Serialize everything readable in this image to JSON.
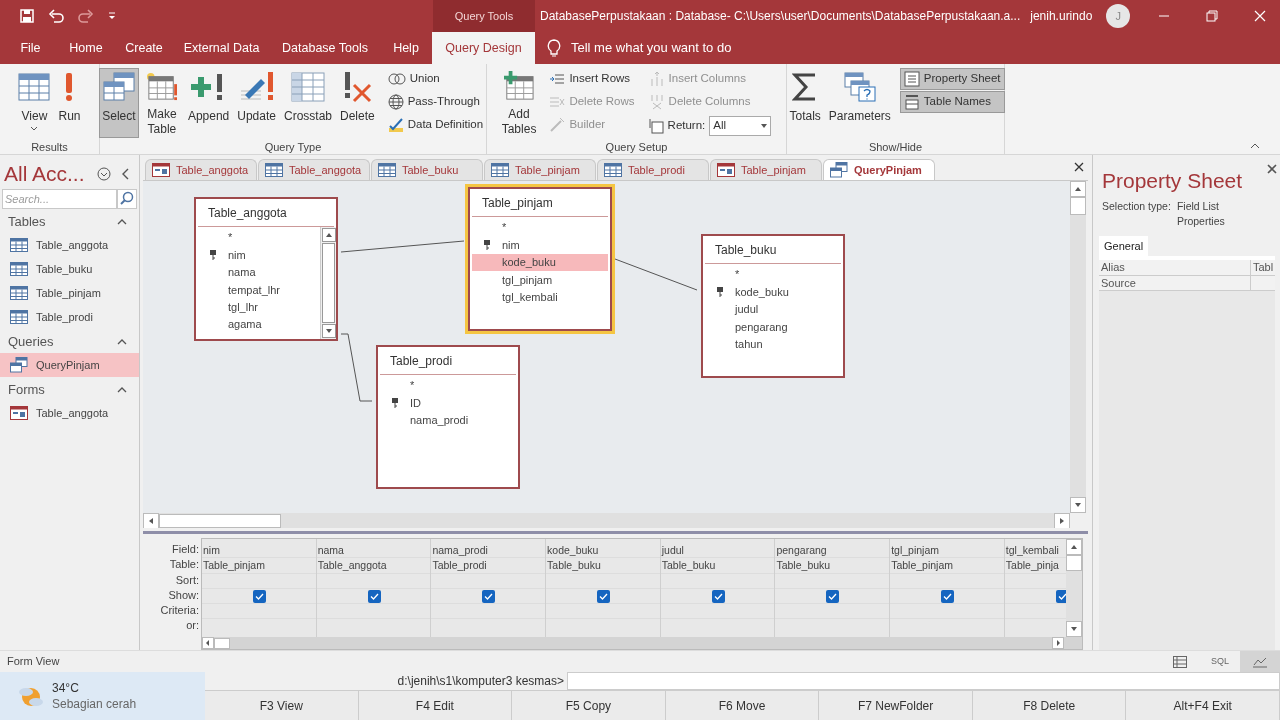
{
  "title_bar": {
    "context_tab": "Query Tools",
    "title": "DatabasePerpustakaan : Database- C:\\Users\\user\\Documents\\DatabasePerpustakaan.a...",
    "user": "jenih.urindo",
    "avatar_initial": "J"
  },
  "ribbon_tabs": [
    {
      "label": "File",
      "selected": false
    },
    {
      "label": "Home",
      "selected": false
    },
    {
      "label": "Create",
      "selected": false
    },
    {
      "label": "External Data",
      "selected": false
    },
    {
      "label": "Database Tools",
      "selected": false
    },
    {
      "label": "Help",
      "selected": false
    },
    {
      "label": "Query Design",
      "selected": true
    }
  ],
  "tell_me": "Tell me what you want to do",
  "ribbon_groups": [
    {
      "label": "Results",
      "commands": [
        {
          "kind": "large",
          "label": "View",
          "selected": false,
          "disabled": false
        },
        {
          "kind": "large",
          "label": "Run",
          "selected": false,
          "disabled": false
        }
      ]
    },
    {
      "label": "Query Type",
      "commands": [
        {
          "kind": "large",
          "label": "Select",
          "selected": true,
          "disabled": false
        },
        {
          "kind": "large",
          "label": "Make Table",
          "selected": false,
          "disabled": false
        },
        {
          "kind": "large",
          "label": "Append",
          "selected": false,
          "disabled": false
        },
        {
          "kind": "large",
          "label": "Update",
          "selected": false,
          "disabled": false
        },
        {
          "kind": "large",
          "label": "Crosstab",
          "selected": false,
          "disabled": false
        },
        {
          "kind": "large",
          "label": "Delete",
          "selected": false,
          "disabled": false
        },
        {
          "kind": "small",
          "label": "Union",
          "selected": false,
          "disabled": false
        },
        {
          "kind": "small",
          "label": "Pass-Through",
          "selected": false,
          "disabled": false
        },
        {
          "kind": "small",
          "label": "Data Definition",
          "selected": false,
          "disabled": false
        }
      ]
    },
    {
      "label": "Query Setup",
      "commands": [
        {
          "kind": "large",
          "label": "Add Tables",
          "selected": false,
          "disabled": false
        },
        {
          "kind": "small",
          "label": "Insert Rows",
          "selected": false,
          "disabled": false
        },
        {
          "kind": "small",
          "label": "Delete Rows",
          "selected": false,
          "disabled": true
        },
        {
          "kind": "small",
          "label": "Builder",
          "selected": false,
          "disabled": true
        },
        {
          "kind": "small",
          "label": "Insert Columns",
          "selected": false,
          "disabled": true
        },
        {
          "kind": "small",
          "label": "Delete Columns",
          "selected": false,
          "disabled": true
        },
        {
          "kind": "dropdown",
          "label": "Return:",
          "value": "All"
        }
      ]
    },
    {
      "label": "Show/Hide",
      "commands": [
        {
          "kind": "large",
          "label": "Totals",
          "selected": false,
          "disabled": false
        },
        {
          "kind": "large",
          "label": "Parameters",
          "selected": false,
          "disabled": false
        },
        {
          "kind": "small",
          "label": "Property Sheet",
          "selected": true,
          "disabled": false
        },
        {
          "kind": "small",
          "label": "Table Names",
          "selected": true,
          "disabled": false
        }
      ]
    }
  ],
  "nav_pane": {
    "title": "All Acc...",
    "search_placeholder": "Search...",
    "groups": [
      {
        "label": "Tables",
        "items": [
          {
            "label": "Table_anggota",
            "kind": "table",
            "selected": false
          },
          {
            "label": "Table_buku",
            "kind": "table",
            "selected": false
          },
          {
            "label": "Table_pinjam",
            "kind": "table",
            "selected": false
          },
          {
            "label": "Table_prodi",
            "kind": "table",
            "selected": false
          }
        ]
      },
      {
        "label": "Queries",
        "items": [
          {
            "label": "QueryPinjam",
            "kind": "query",
            "selected": true
          }
        ]
      },
      {
        "label": "Forms",
        "items": [
          {
            "label": "Table_anggota",
            "kind": "form",
            "selected": false
          }
        ]
      }
    ]
  },
  "document_tabs": [
    {
      "label": "Table_anggota",
      "kind": "form",
      "selected": false
    },
    {
      "label": "Table_anggota",
      "kind": "table",
      "selected": false
    },
    {
      "label": "Table_buku",
      "kind": "table",
      "selected": false
    },
    {
      "label": "Table_pinjam",
      "kind": "table",
      "selected": false
    },
    {
      "label": "Table_prodi",
      "kind": "table",
      "selected": false
    },
    {
      "label": "Table_pinjam",
      "kind": "form",
      "selected": false
    },
    {
      "label": "QueryPinjam",
      "kind": "query",
      "selected": true
    }
  ],
  "field_lists": [
    {
      "title": "Table_anggota",
      "focused": false,
      "scrollbar": true,
      "fields": [
        {
          "name": "*",
          "key": false,
          "selected": false
        },
        {
          "name": "nim",
          "key": true,
          "selected": false
        },
        {
          "name": "nama",
          "key": false,
          "selected": false
        },
        {
          "name": "tempat_lhr",
          "key": false,
          "selected": false
        },
        {
          "name": "tgl_lhr",
          "key": false,
          "selected": false
        },
        {
          "name": "agama",
          "key": false,
          "selected": false
        }
      ]
    },
    {
      "title": "Table_pinjam",
      "focused": true,
      "scrollbar": false,
      "fields": [
        {
          "name": "*",
          "key": false,
          "selected": false
        },
        {
          "name": "nim",
          "key": true,
          "selected": false
        },
        {
          "name": "kode_buku",
          "key": false,
          "selected": true
        },
        {
          "name": "tgl_pinjam",
          "key": false,
          "selected": false
        },
        {
          "name": "tgl_kembali",
          "key": false,
          "selected": false
        }
      ]
    },
    {
      "title": "Table_buku",
      "focused": false,
      "scrollbar": false,
      "fields": [
        {
          "name": "*",
          "key": false,
          "selected": false
        },
        {
          "name": "kode_buku",
          "key": true,
          "selected": false
        },
        {
          "name": "judul",
          "key": false,
          "selected": false
        },
        {
          "name": "pengarang",
          "key": false,
          "selected": false
        },
        {
          "name": "tahun",
          "key": false,
          "selected": false
        }
      ]
    },
    {
      "title": "Table_prodi",
      "focused": false,
      "scrollbar": false,
      "fields": [
        {
          "name": "*",
          "key": false,
          "selected": false
        },
        {
          "name": "ID",
          "key": true,
          "selected": false
        },
        {
          "name": "nama_prodi",
          "key": false,
          "selected": false
        }
      ]
    }
  ],
  "query_grid": {
    "row_labels": [
      "Field:",
      "Table:",
      "Sort:",
      "Show:",
      "Criteria:",
      "or:"
    ],
    "columns": [
      {
        "field": "nim",
        "table": "Table_pinjam",
        "show": true
      },
      {
        "field": "nama",
        "table": "Table_anggota",
        "show": true
      },
      {
        "field": "nama_prodi",
        "table": "Table_prodi",
        "show": true
      },
      {
        "field": "kode_buku",
        "table": "Table_buku",
        "show": true
      },
      {
        "field": "judul",
        "table": "Table_buku",
        "show": true
      },
      {
        "field": "pengarang",
        "table": "Table_buku",
        "show": true
      },
      {
        "field": "tgl_pinjam",
        "table": "Table_pinjam",
        "show": true
      },
      {
        "field": "tgl_kembali",
        "table": "Table_pinja",
        "show": true
      }
    ]
  },
  "property_sheet": {
    "title": "Property Sheet",
    "selection_type_label": "Selection type:",
    "selection_type": "Field List Properties",
    "tabs": [
      {
        "label": "General",
        "selected": true
      }
    ],
    "rows": [
      {
        "name": "Alias",
        "value": "Tabl"
      },
      {
        "name": "Source"
      }
    ]
  },
  "status_bar": {
    "text": "Form View",
    "views": [
      {
        "kind": "datasheet",
        "selected": false
      },
      {
        "kind": "sql",
        "label": "SQL",
        "selected": false
      },
      {
        "kind": "design",
        "selected": true
      }
    ]
  },
  "taskbar": {
    "weather": {
      "temperature": "34°C",
      "condition": "Sebagian cerah"
    },
    "prompt": "d:\\jenih\\s1\\komputer3 kesmas>",
    "function_keys": [
      "F3 View",
      "F4 Edit",
      "F5 Copy",
      "F6 Move",
      "F7 NewFolder",
      "F8 Delete",
      "Alt+F4 Exit"
    ]
  }
}
